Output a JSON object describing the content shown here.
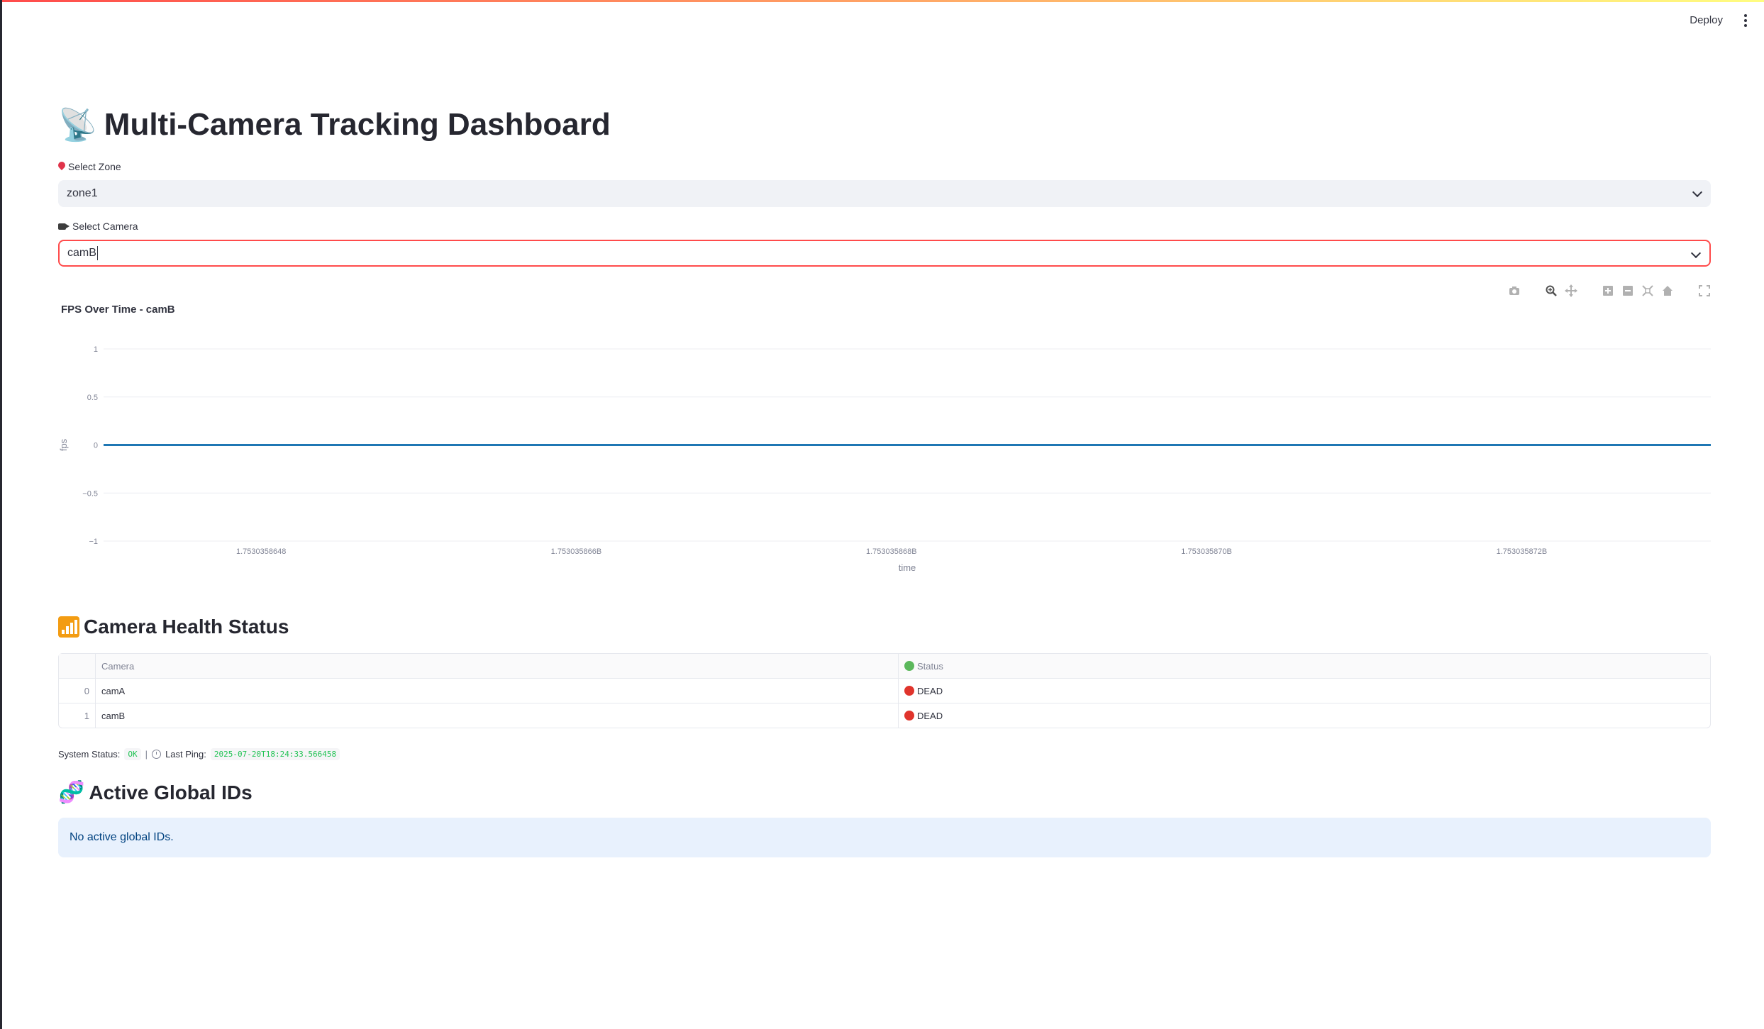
{
  "header": {
    "deploy_label": "Deploy",
    "menu_icon": "more-vert-icon"
  },
  "page": {
    "title": "Multi-Camera Tracking Dashboard",
    "title_emoji": "📡"
  },
  "zone_select": {
    "label": "Select Zone",
    "icon": "pin-icon",
    "value": "zone1"
  },
  "camera_select": {
    "label": "Select Camera",
    "icon": "video-camera-icon",
    "value": "camB"
  },
  "chart": {
    "title": "FPS Over Time - camB",
    "modebar_icons": [
      "camera-icon",
      "zoom-icon",
      "pan-icon",
      "zoom-in-icon",
      "zoom-out-icon",
      "autoscale-icon",
      "reset-axes-icon",
      "fullscreen-icon"
    ]
  },
  "chart_data": {
    "type": "line",
    "title": "FPS Over Time - camB",
    "xlabel": "time",
    "ylabel": "fps",
    "x_tick_labels": [
      "1.7530358648",
      "1.753035866B",
      "1.753035868B",
      "1.753035870B",
      "1.753035872B"
    ],
    "y_tick_labels": [
      "1",
      "0.5",
      "0",
      "−0.5",
      "−1"
    ],
    "ylim": [
      -1,
      1
    ],
    "grid": true,
    "series": [
      {
        "color": "#1f77b4",
        "x": [
          1753035863,
          1753035873.2
        ],
        "values": [
          0,
          0
        ]
      }
    ]
  },
  "health": {
    "title": "Camera Health Status",
    "title_icon": "signal-bars-icon",
    "columns": [
      "",
      "Camera",
      "Status"
    ],
    "status_header_icon": "green-circle-icon",
    "rows": [
      {
        "index": "0",
        "camera": "camA",
        "status": "DEAD",
        "status_icon": "red-circle-icon"
      },
      {
        "index": "1",
        "camera": "camB",
        "status": "DEAD",
        "status_icon": "red-circle-icon"
      }
    ]
  },
  "system": {
    "status_label": "System Status:",
    "status_value": "OK",
    "separator": "|",
    "ping_label": "Last Ping:",
    "ping_value": "2025-07-20T18:24:33.566458"
  },
  "global_ids": {
    "title": "Active Global IDs",
    "title_emoji": "🧬",
    "message": "No active global IDs."
  },
  "colors": {
    "accent": "#ff4b4b",
    "line": "#1f77b4",
    "info_bg": "#e8f1fd",
    "ok_code": "#21c354"
  }
}
